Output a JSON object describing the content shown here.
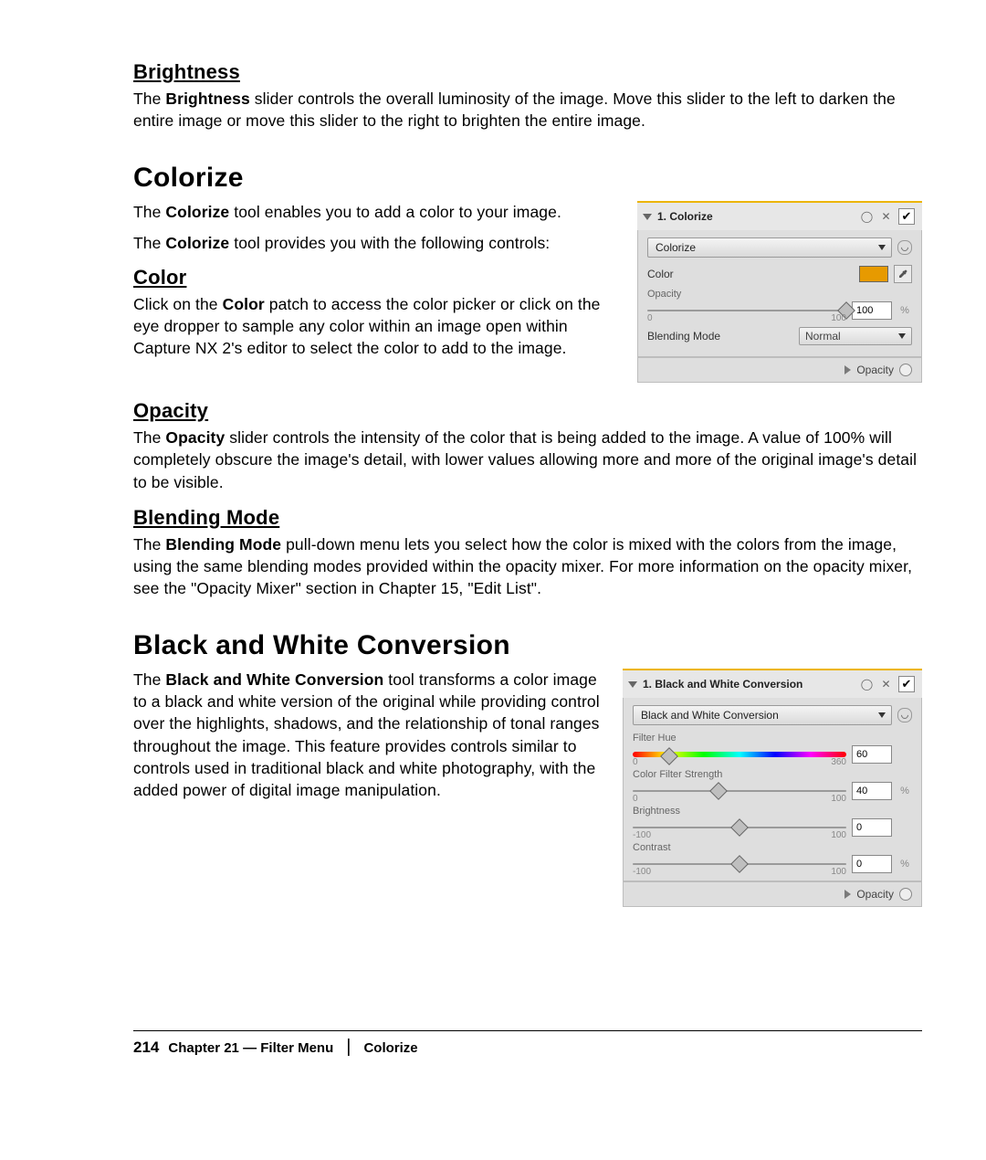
{
  "sections": {
    "brightness": {
      "heading": "Brightness",
      "para_before": "The ",
      "para_bold": "Brightness",
      "para_after": " slider controls the overall luminosity of the image. Move this slider to the left to darken the entire image or move this slider to the right to brighten the entire image."
    },
    "colorize": {
      "heading": "Colorize",
      "intro1_before": "The ",
      "intro1_bold": "Colorize",
      "intro1_after": " tool enables you to add a color to your image.",
      "intro2_before": "The ",
      "intro2_bold": "Colorize",
      "intro2_after": " tool provides you with the following controls:",
      "color": {
        "heading": "Color",
        "para_before": "Click on the ",
        "para_bold": "Color",
        "para_after": " patch to access the color picker or click on the eye dropper to sample any color within an image open within Capture NX 2's editor to select the color to add to the image."
      },
      "opacity": {
        "heading": "Opacity",
        "para_before": "The ",
        "para_bold": "Opacity",
        "para_after": " slider controls the intensity of the color that is being added to the image. A value of 100% will completely obscure the image's detail, with lower values allowing more and more of the original image's detail to be visible."
      },
      "blending": {
        "heading": "Blending Mode",
        "para_before": "The ",
        "para_bold": "Blending Mode",
        "para_after": " pull-down menu lets you select how the color is mixed with the colors from the image, using the same blending modes provided within the opacity mixer. For more information on the opacity mixer, see the \"Opacity Mixer\" section in Chapter 15, \"Edit List\"."
      }
    },
    "bw": {
      "heading": "Black and White Conversion",
      "para_before": "The ",
      "para_bold": "Black and White Conversion",
      "para_after": " tool transforms a color image to a black and white version of the original while providing control over the highlights, shadows, and the relationship of tonal ranges throughout the image. This feature provides controls similar to controls used in traditional black and white photography, with the added power of digital image manipulation."
    }
  },
  "panels": {
    "colorize": {
      "title": "1. Colorize",
      "select": "Colorize",
      "rows": {
        "color_label": "Color",
        "opacity_label": "Opacity",
        "opacity_min": "0",
        "opacity_max": "100",
        "opacity_value": "100",
        "opacity_unit": "%",
        "blending_label": "Blending Mode",
        "blending_value": "Normal"
      },
      "footer": "Opacity",
      "swatch_color": "#e79a00"
    },
    "bw": {
      "title": "1. Black and White Conversion",
      "select": "Black and White Conversion",
      "filter_hue": {
        "label": "Filter Hue",
        "min": "0",
        "max": "360",
        "value": "60",
        "unit": ""
      },
      "strength": {
        "label": "Color Filter Strength",
        "min": "0",
        "max": "100",
        "value": "40",
        "unit": "%"
      },
      "brightness": {
        "label": "Brightness",
        "min": "-100",
        "max": "100",
        "value": "0",
        "unit": ""
      },
      "contrast": {
        "label": "Contrast",
        "min": "-100",
        "max": "100",
        "value": "0",
        "unit": "%"
      },
      "footer": "Opacity"
    }
  },
  "footer": {
    "page": "214",
    "chapter": "Chapter 21 — Filter Menu",
    "section": "Colorize"
  }
}
